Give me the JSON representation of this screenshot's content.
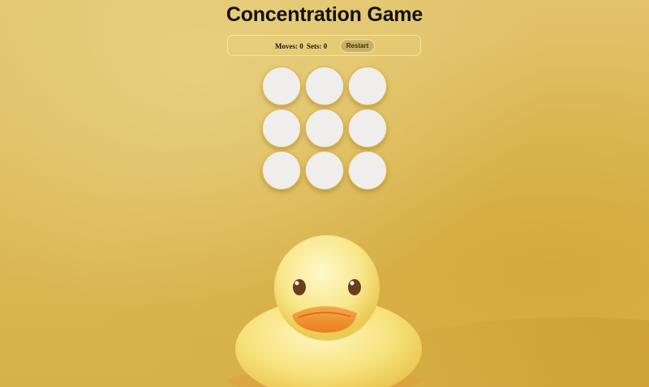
{
  "title": "Concentration Game",
  "stats": {
    "moves_label": "Moves:",
    "moves_value": "0",
    "sets_label": "Sets:",
    "sets_value": "0",
    "restart_label": "Restart"
  },
  "board": {
    "rows": 3,
    "columns": 3,
    "cards": [
      {
        "state": "face-down"
      },
      {
        "state": "face-down"
      },
      {
        "state": "face-down"
      },
      {
        "state": "face-down"
      },
      {
        "state": "face-down"
      },
      {
        "state": "face-down"
      },
      {
        "state": "face-down"
      },
      {
        "state": "face-down"
      },
      {
        "state": "face-down"
      }
    ]
  },
  "background": {
    "image": "rubber-duck-photo",
    "colors": {
      "backdrop": "#dcb956",
      "card_face": "#efeeec",
      "card_border": "#e3b64a",
      "restart_button": "#c9b162"
    }
  }
}
